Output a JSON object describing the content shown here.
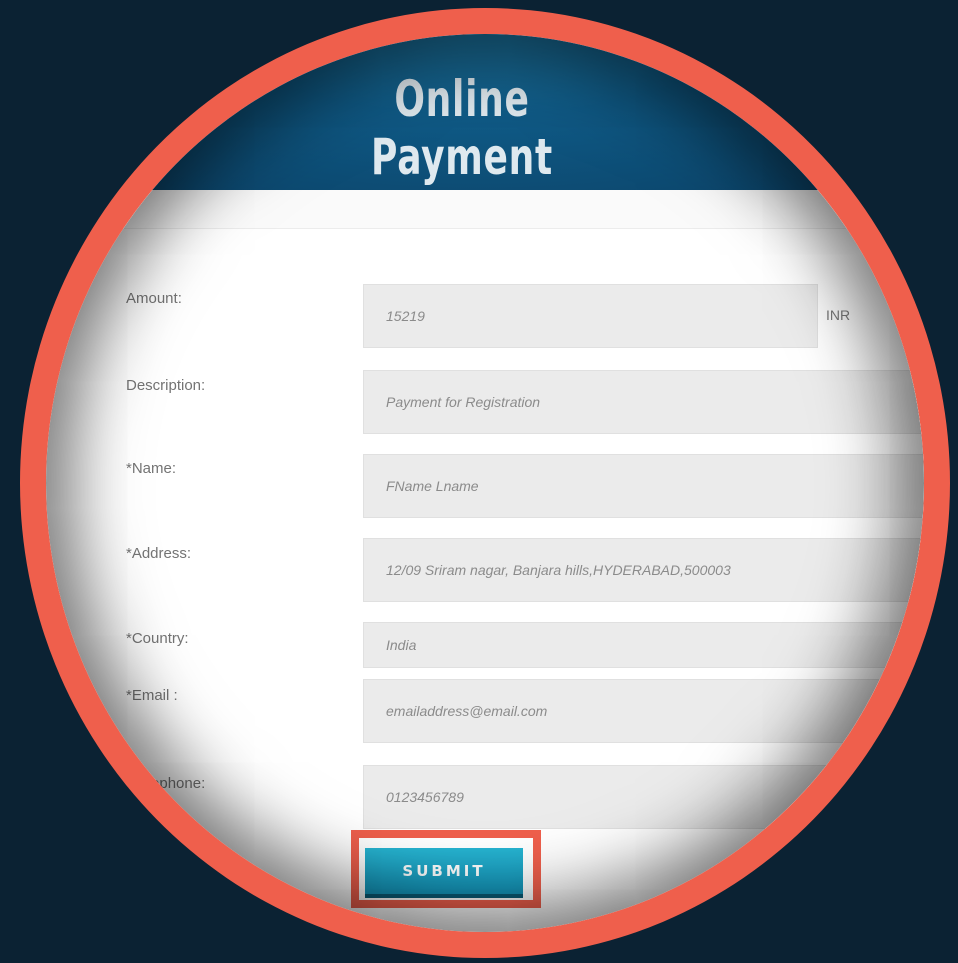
{
  "header": {
    "title": "Online Payment"
  },
  "form": {
    "amount": {
      "label": "Amount:",
      "value": "15219",
      "unit": "INR"
    },
    "description": {
      "label": "Description:",
      "value": "Payment for Registration"
    },
    "name": {
      "label": "*Name:",
      "value": "FName Lname"
    },
    "address": {
      "label": "*Address:",
      "value": "12/09 Sriram nagar, Banjara hills,HYDERABAD,500003"
    },
    "country": {
      "label": "*Country:",
      "value": "India"
    },
    "email": {
      "label": "*Email :",
      "value": "emailaddress@email.com"
    },
    "telephone": {
      "label": "*Telephone:",
      "value": "0123456789"
    },
    "submit_label": "SUBMIT"
  },
  "colors": {
    "background": "#0b2233",
    "ring": "#ef5f4c",
    "header": "#0f5a86",
    "button": "#1a9fc2"
  }
}
